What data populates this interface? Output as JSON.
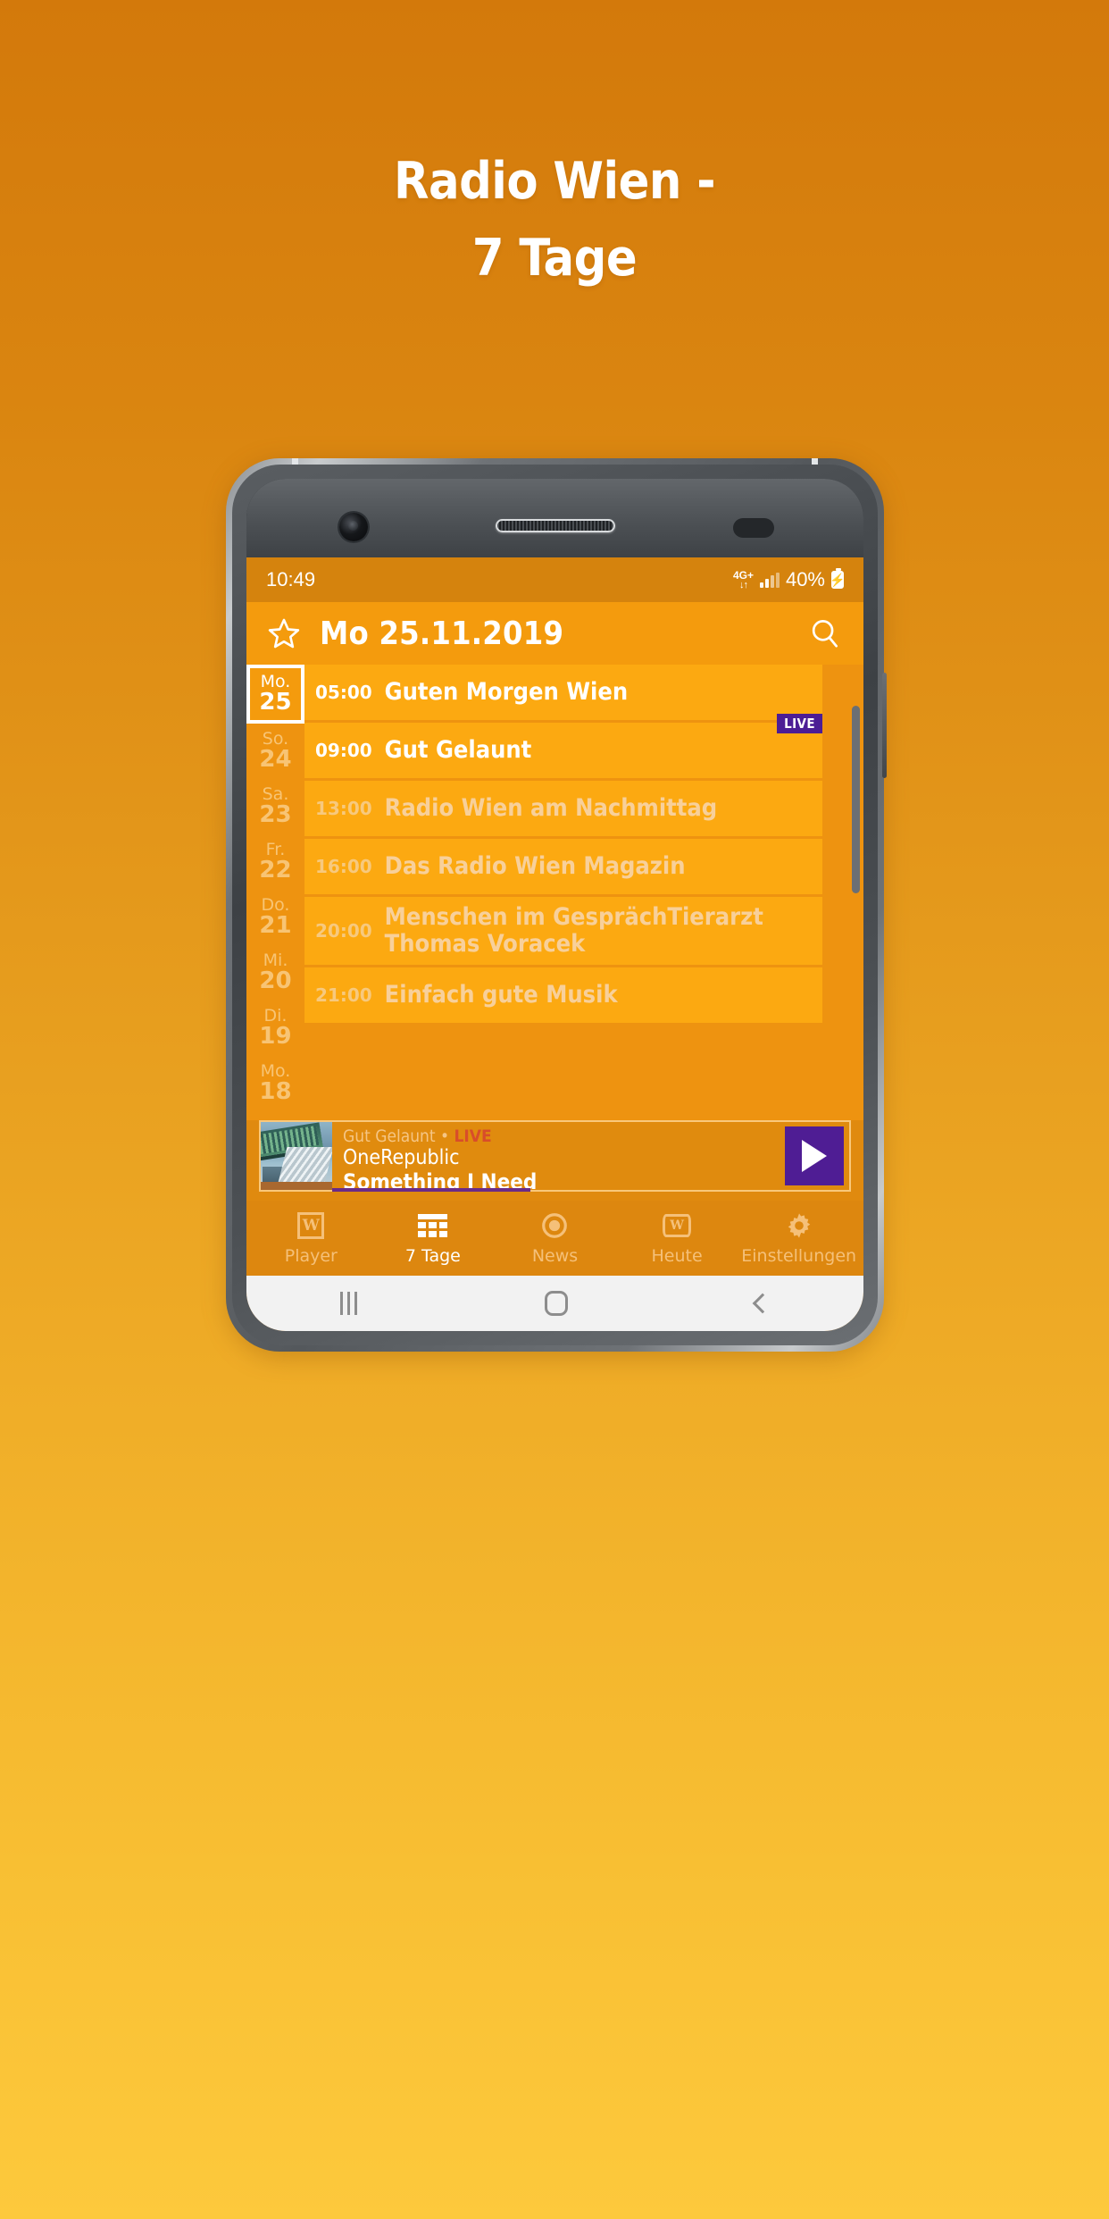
{
  "store": {
    "headline_line1": "Radio Wien -",
    "headline_line2": "7 Tage"
  },
  "status_bar": {
    "time": "10:49",
    "network": "4G+",
    "network_arrows": "↓↑",
    "battery_percent": "40%",
    "battery_icon": "charging-battery-icon"
  },
  "app_bar": {
    "favorite_icon": "star-outline-icon",
    "title": "Mo 25.11.2019",
    "search_icon": "search-icon"
  },
  "days": [
    {
      "weekday": "Mo.",
      "daynum": "25",
      "selected": true
    },
    {
      "weekday": "So.",
      "daynum": "24",
      "selected": false
    },
    {
      "weekday": "Sa.",
      "daynum": "23",
      "selected": false
    },
    {
      "weekday": "Fr.",
      "daynum": "22",
      "selected": false
    },
    {
      "weekday": "Do.",
      "daynum": "21",
      "selected": false
    },
    {
      "weekday": "Mi.",
      "daynum": "20",
      "selected": false
    },
    {
      "weekday": "Di.",
      "daynum": "19",
      "selected": false
    },
    {
      "weekday": "Mo.",
      "daynum": "18",
      "selected": false
    }
  ],
  "programs": [
    {
      "time": "05:00",
      "name": "Guten Morgen Wien",
      "past": true,
      "live": false
    },
    {
      "time": "09:00",
      "name": "Gut Gelaunt",
      "past": true,
      "live": true,
      "live_label": "LIVE"
    },
    {
      "time": "13:00",
      "name": "Radio Wien am Nachmittag",
      "past": false,
      "live": false
    },
    {
      "time": "16:00",
      "name": "Das Radio Wien Magazin",
      "past": false,
      "live": false
    },
    {
      "time": "20:00",
      "name": "Menschen im GesprächTierarzt Thomas Voracek",
      "past": false,
      "live": false
    },
    {
      "time": "21:00",
      "name": "Einfach gute Musik",
      "past": false,
      "live": false
    }
  ],
  "now_playing": {
    "show": "Gut Gelaunt • ",
    "live_label": "LIVE",
    "artist": "OneRepublic",
    "track": "Something I Need",
    "play_icon": "play-icon",
    "artwork": "radio-station-building-photo"
  },
  "tabs": [
    {
      "label": "Player",
      "icon": "w-logo-icon",
      "active": false
    },
    {
      "label": "7 Tage",
      "icon": "grid-icon",
      "active": true
    },
    {
      "label": "News",
      "icon": "target-icon",
      "active": false
    },
    {
      "label": "Heute",
      "icon": "tv-w-icon",
      "active": false
    },
    {
      "label": "Einstellungen",
      "icon": "gear-icon",
      "active": false
    }
  ],
  "android_nav": {
    "recents_icon": "recents-icon",
    "home_icon": "home-icon",
    "back_icon": "back-icon"
  },
  "colors": {
    "brand_orange": "#f49b0d",
    "deep_orange": "#d3790b",
    "gold": "#fdc93c",
    "purple": "#4f1d94",
    "live_red": "#d84d2a"
  }
}
